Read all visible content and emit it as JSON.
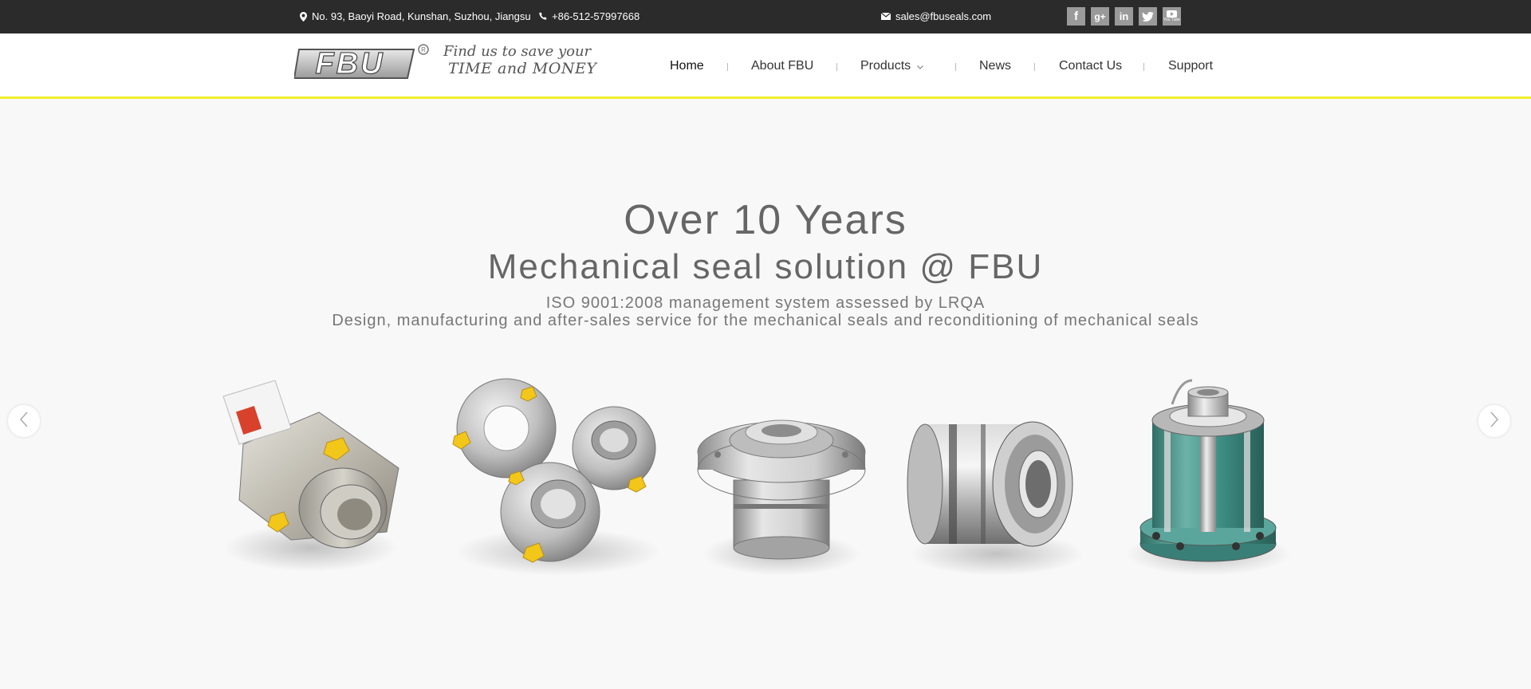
{
  "topbar": {
    "address": "No. 93, Baoyi Road, Kunshan, Suzhou, Jiangsu",
    "phone": "+86-512-57997668",
    "email": "sales@fbuseals.com",
    "social": [
      {
        "label": "f",
        "icon": "facebook-icon"
      },
      {
        "label": "g+",
        "icon": "google-plus-icon"
      },
      {
        "label": "in",
        "icon": "linkedin-icon"
      },
      {
        "label": "t",
        "icon": "twitter-icon"
      },
      {
        "label": "You Tube",
        "icon": "youtube-icon"
      }
    ]
  },
  "header": {
    "logo_text": "FBU",
    "tagline_line1": "Find us to save your",
    "tagline_line2": "TIME and MONEY"
  },
  "nav": {
    "items": [
      {
        "label": "Home",
        "active": true
      },
      {
        "label": "About FBU"
      },
      {
        "label": "Products",
        "has_dropdown": true
      },
      {
        "label": "News"
      },
      {
        "label": "Contact Us"
      },
      {
        "label": "Support"
      }
    ]
  },
  "hero": {
    "title": "Over 10 Years",
    "subtitle": "Mechanical seal solution @ FBU",
    "line1": "ISO 9001:2008 management system assessed by LRQA",
    "line2": "Design, manufacturing and after-sales service for the mechanical seals and reconditioning of mechanical seals"
  },
  "colors": {
    "topbar_bg": "#2b2b2b",
    "header_border": "#f0f028",
    "hero_bg": "#f8f8f8",
    "accent_yellow": "#f3c61a",
    "seal_teal": "#3f8f86"
  }
}
